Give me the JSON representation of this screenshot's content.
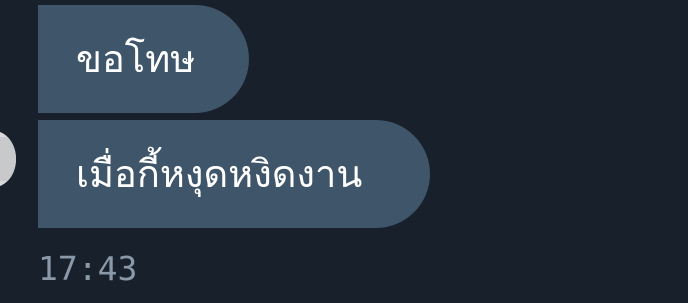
{
  "chat": {
    "messages": [
      {
        "text": "ขอโทษ"
      },
      {
        "text": "เมื่อกี้หงุดหงิดงาน"
      }
    ],
    "timestamp": "17:43"
  },
  "colors": {
    "background": "#18202b",
    "bubble": "#3e556a",
    "message_text": "#ffffff",
    "timestamp_text": "#8a98a8",
    "avatar": "#d9dadc"
  },
  "icons": {
    "avatar": "sender-avatar"
  }
}
